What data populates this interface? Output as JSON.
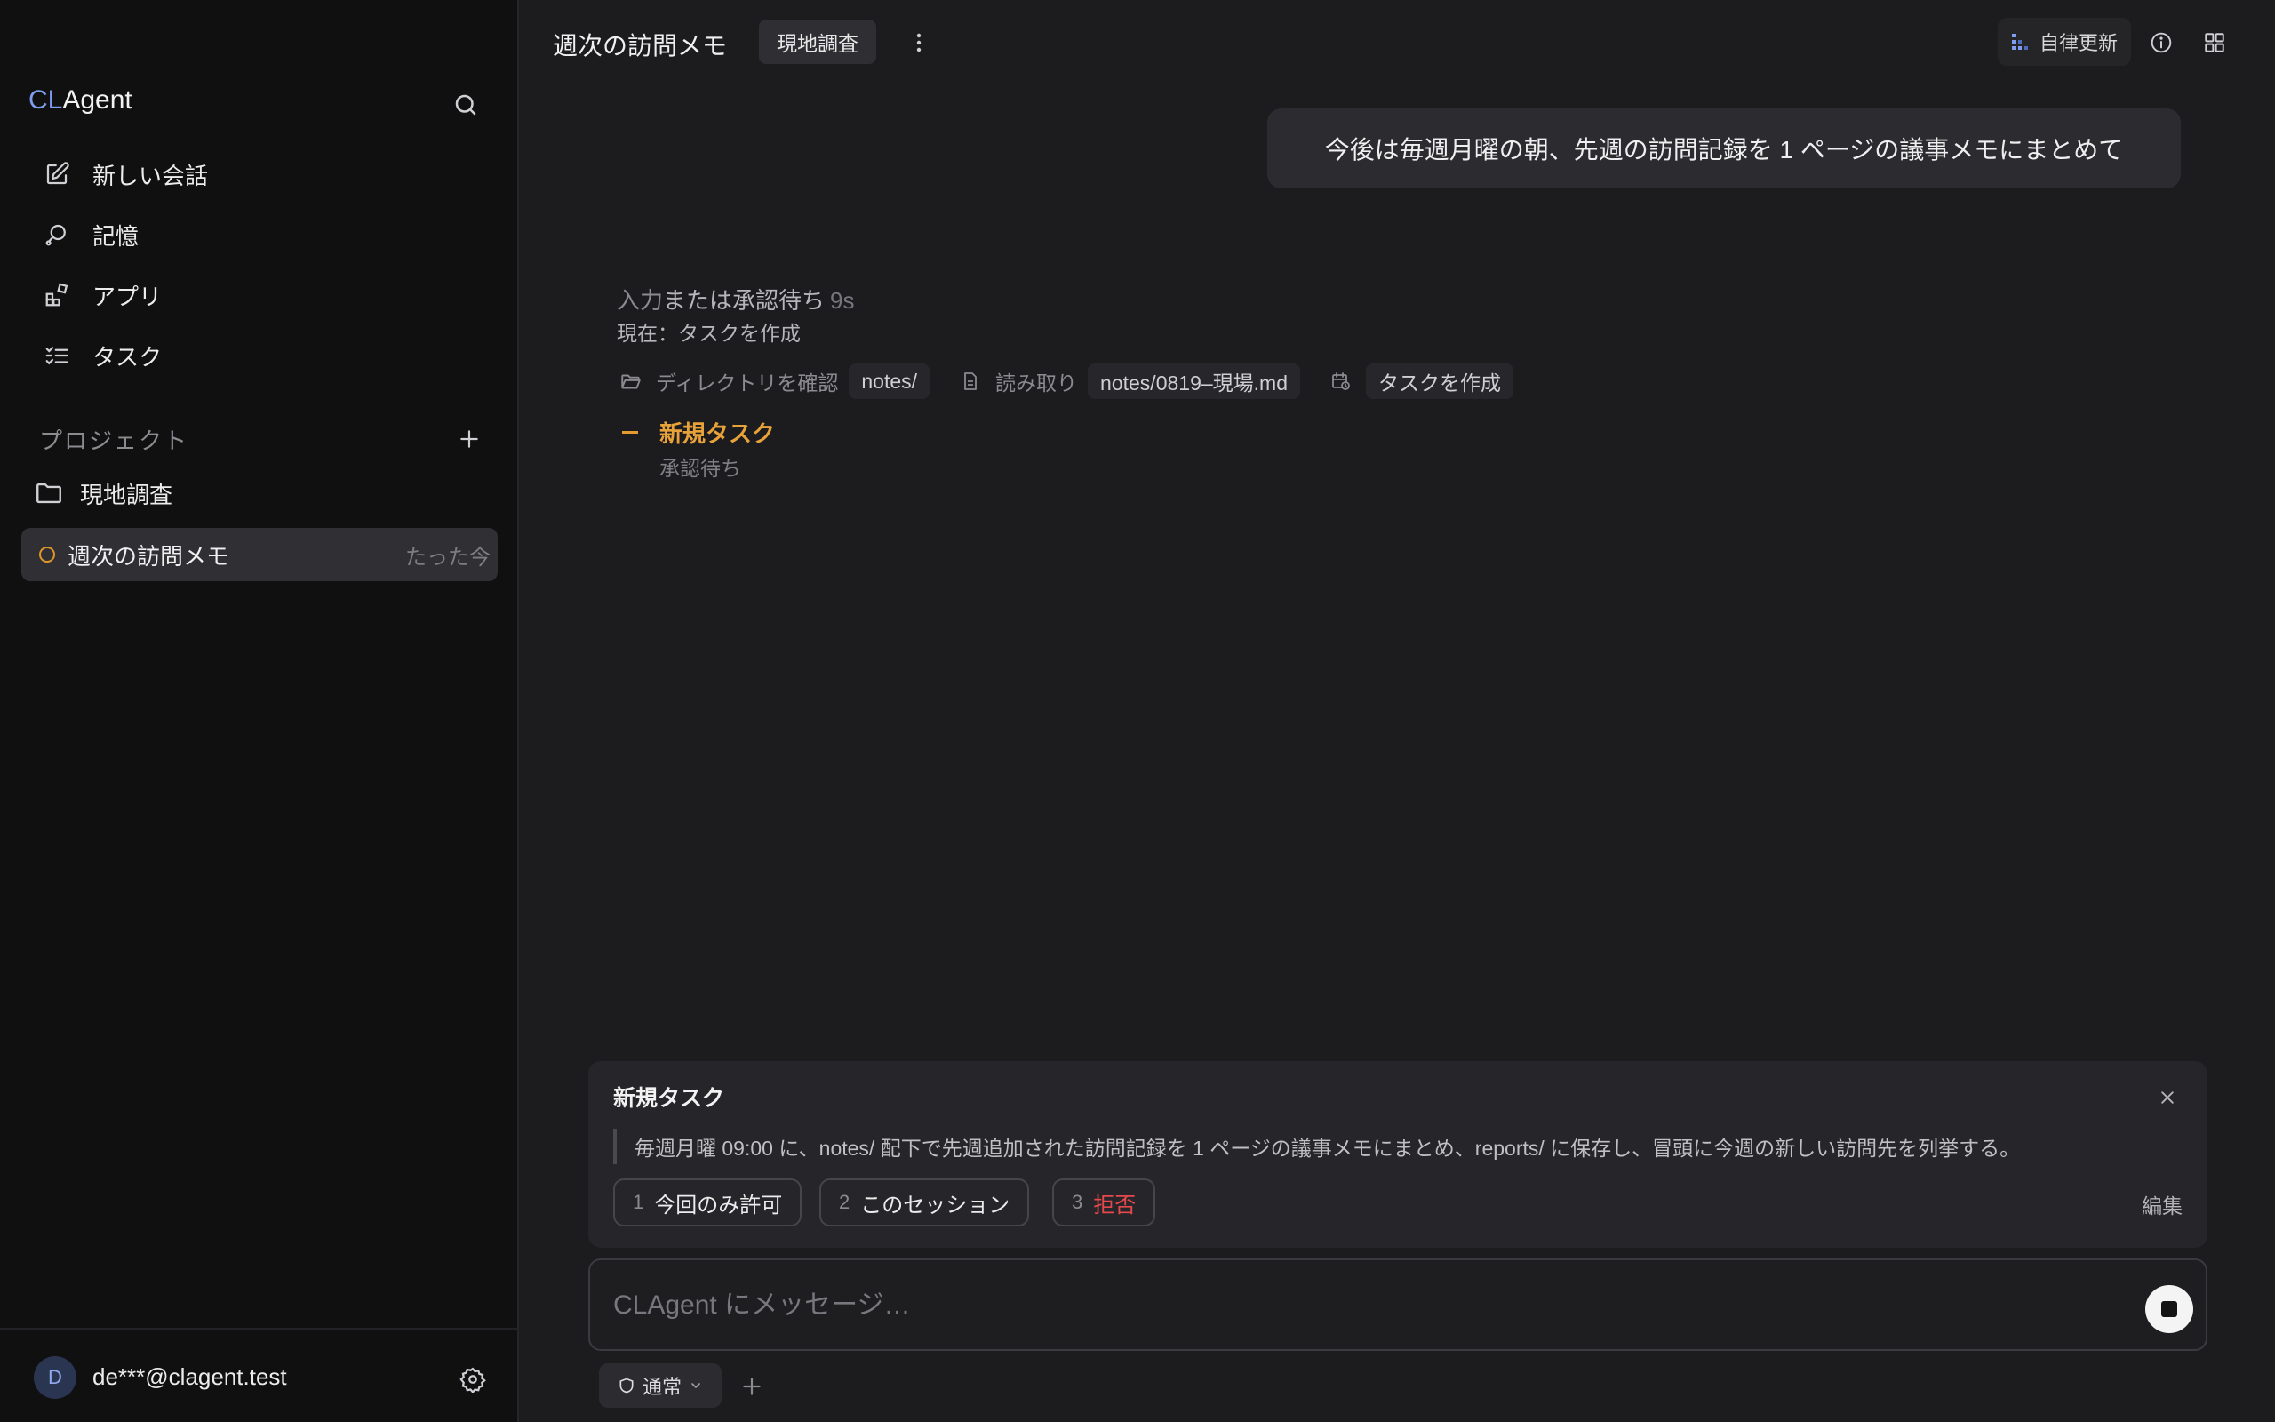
{
  "sidebar": {
    "brand_prefix": "CL",
    "brand_suffix": "Agent",
    "nav": [
      {
        "label": "新しい会話",
        "icon": "edit-icon"
      },
      {
        "label": "記憶",
        "icon": "memory-icon"
      },
      {
        "label": "アプリ",
        "icon": "apps-icon"
      },
      {
        "label": "タスク",
        "icon": "tasks-icon"
      }
    ],
    "projects_label": "プロジェクト",
    "project_name": "現地調査",
    "session": {
      "title": "週次の訪問メモ",
      "time": "たった今"
    },
    "user": {
      "initial": "D",
      "email": "de***@clagent.test"
    }
  },
  "header": {
    "title": "週次の訪問メモ",
    "project_tag": "現地調査",
    "auto_update": "自律更新"
  },
  "conversation": {
    "user_message": "今後は毎週月曜の朝、先週の訪問記録を 1 ページの議事メモにまとめて",
    "status_prefix": "入力",
    "status_strong": "または承認待ち",
    "status_seconds": "9s",
    "current": "現在：タスクを作成",
    "steps": [
      {
        "label": "ディレクトリを確認",
        "chip": "notes/"
      },
      {
        "label": "読み取り",
        "chip": "notes/0819–現場.md"
      },
      {
        "label": "",
        "chip": "タスクを作成"
      }
    ],
    "new_task_label": "新規タスク",
    "new_task_status": "承認待ち"
  },
  "approval": {
    "title": "新規タスク",
    "description": "毎週月曜 09:00 に、notes/ 配下で先週追加された訪問記録を 1 ページの議事メモにまとめ、reports/ に保存し、冒頭に今週の新しい訪問先を列挙する。",
    "options": [
      {
        "num": "1",
        "label": "今回のみ許可"
      },
      {
        "num": "2",
        "label": "このセッション"
      },
      {
        "num": "3",
        "label": "拒否"
      }
    ],
    "edit_label": "編集"
  },
  "composer": {
    "placeholder": "CLAgent にメッセージ…",
    "mode": "通常"
  },
  "colors": {
    "accent_blue": "#7e9cf0",
    "pending_orange": "#e8a23a",
    "deny_red": "#e5484d"
  }
}
